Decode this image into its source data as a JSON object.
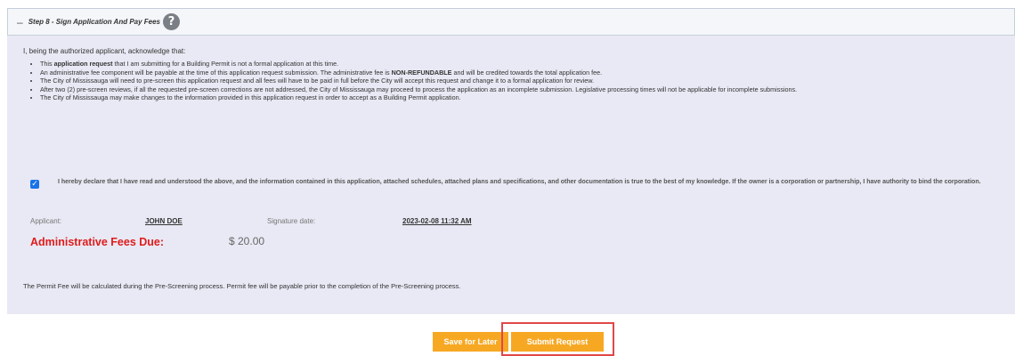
{
  "step": {
    "collapse_symbol": "–",
    "title": "Step 8 - Sign Application And Pay Fees",
    "help_symbol": "?"
  },
  "intro": "I, being the authorized applicant, acknowledge that:",
  "bullets": {
    "b1": {
      "pre": "This ",
      "bold": "application request",
      "post": " that I am submitting for a Building Permit is not a formal application at this time."
    },
    "b2": {
      "pre": "An administrative fee component will be payable at the time of this application request submission. The administrative fee is ",
      "bold": "NON-REFUNDABLE",
      "post": " and will be credited towards the total application fee."
    },
    "b3": "The City of Mississauga will need to pre-screen this application request and all fees will have to be paid in full before the City will accept this request and change it to a formal application for review.",
    "b4": "After two (2) pre-screen reviews, if all the requested pre-screen corrections are not addressed, the City of Mississauga may proceed to process the application as an incomplete submission. Legislative processing times will not be applicable for incomplete submissions.",
    "b5": "The City of Mississauga may make changes to the information provided in this application request in order to accept as a Building Permit application."
  },
  "declaration": {
    "checked_symbol": "✓",
    "text": "I hereby declare that I have read and understood the above, and the information contained in this application, attached schedules, attached plans and specifications, and other documentation is true to the best of my knowledge. If the owner is a corporation or partnership, I have authority to bind the corporation."
  },
  "signature": {
    "applicant_label": "Applicant:",
    "applicant_value": "JOHN DOE",
    "date_label": "Signature date:",
    "date_value": "2023-02-08 11:32 AM"
  },
  "fees": {
    "label": "Administrative Fees Due:",
    "value": "$ 20.00"
  },
  "permit_note": "The Permit Fee will be calculated during the Pre-Screening process. Permit fee will be payable prior to the completion of the Pre-Screening process.",
  "buttons": {
    "save": "Save for Later",
    "submit": "Submit Request"
  },
  "colors": {
    "button": "#f7a823",
    "fees_label": "#e01b1b",
    "highlight": "#e04848",
    "checkbox": "#1a73e8"
  }
}
